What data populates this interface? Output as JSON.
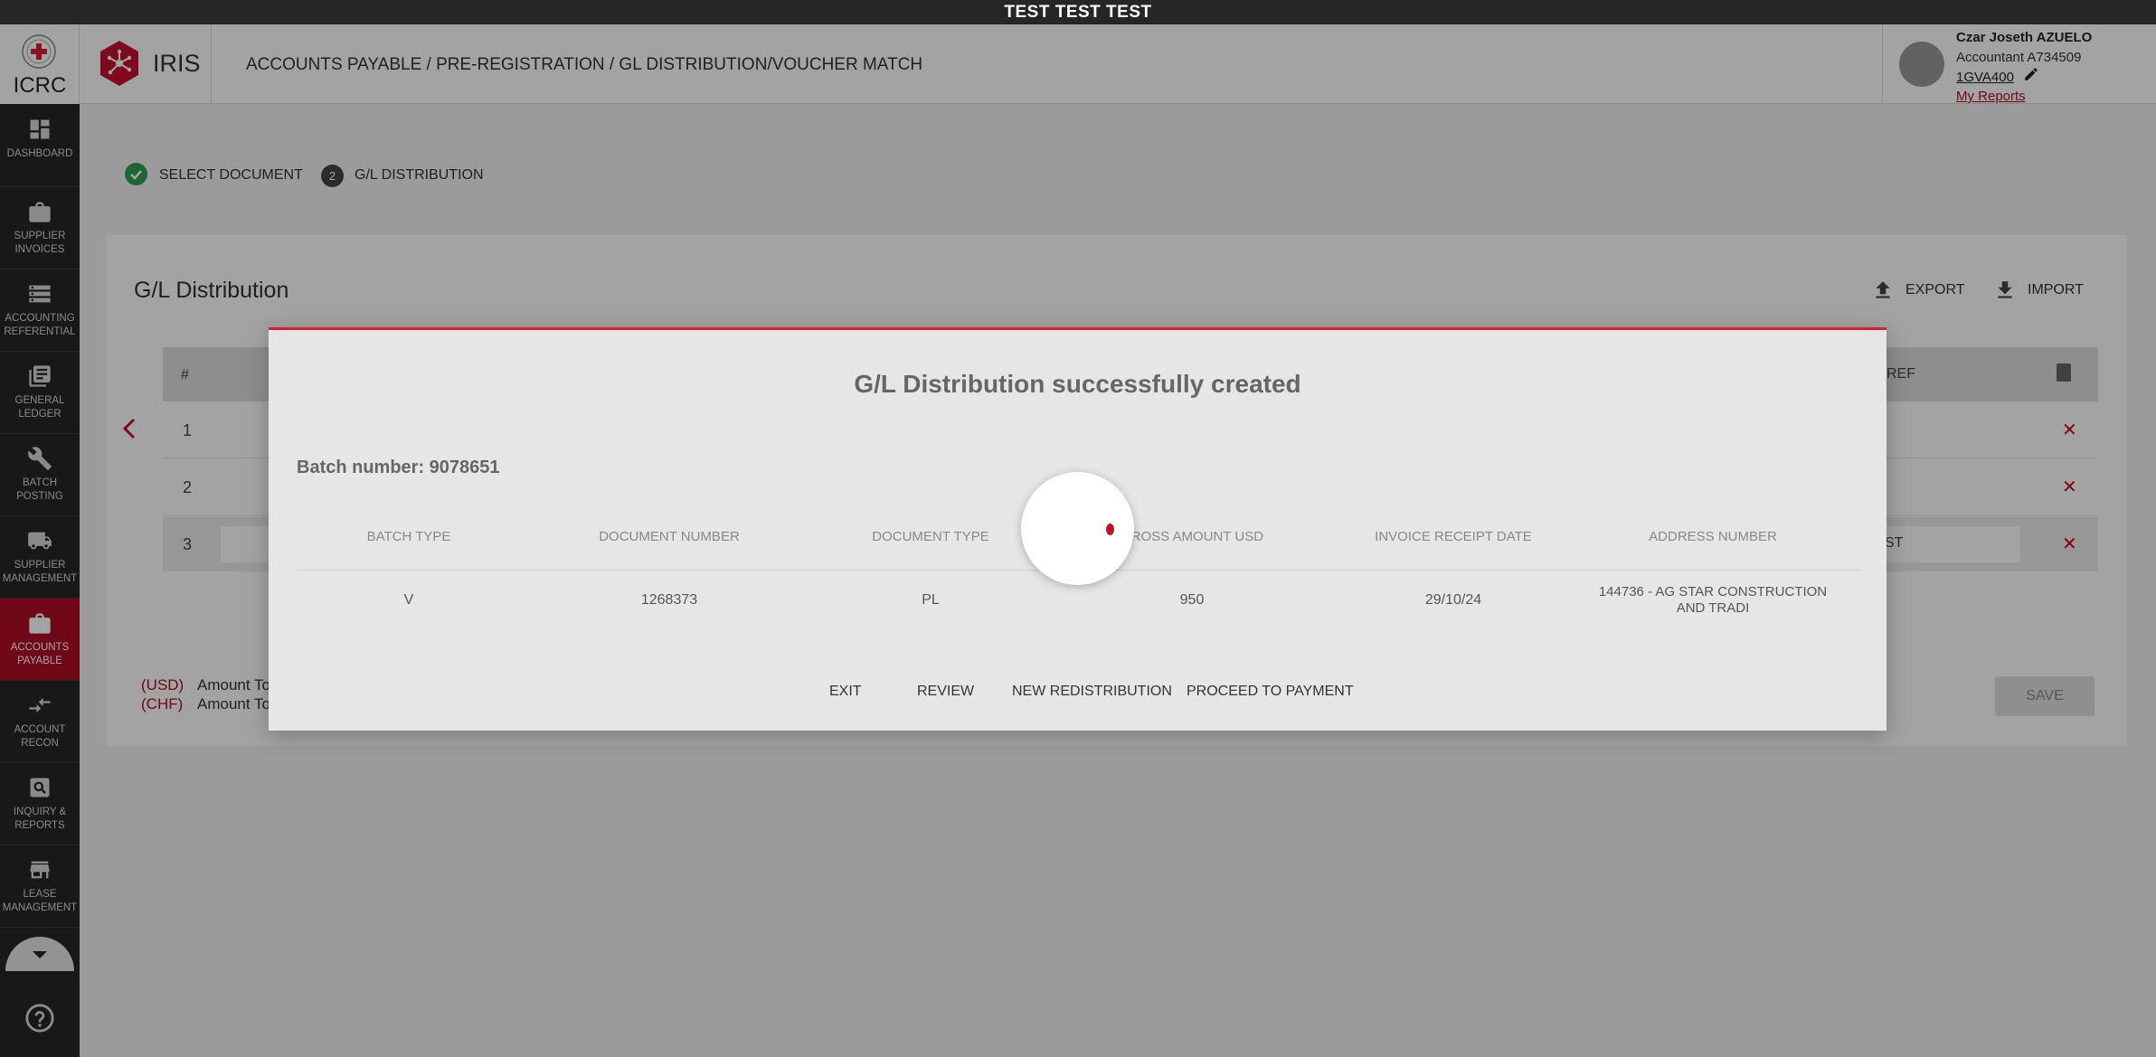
{
  "env_banner": "TEST TEST TEST",
  "brand": {
    "org": "ICRC",
    "app": "IRIS"
  },
  "header": {
    "breadcrumb": "ACCOUNTS PAYABLE / PRE-REGISTRATION / GL DISTRIBUTION/VOUCHER MATCH"
  },
  "user": {
    "name": "Czar Joseth AZUELO",
    "role": "Accountant A734509",
    "code": "1GVA400",
    "reports_link": "My Reports"
  },
  "sidebar": {
    "items": [
      {
        "label": "DASHBOARD",
        "icon": "dashboard-icon"
      },
      {
        "label": "SUPPLIER\nINVOICES",
        "icon": "briefcase-icon"
      },
      {
        "label": "ACCOUNTING\nREFERENTIAL",
        "icon": "storage-icon"
      },
      {
        "label": "GENERAL\nLEDGER",
        "icon": "library-books-icon"
      },
      {
        "label": "BATCH\nPOSTING",
        "icon": "wrench-icon"
      },
      {
        "label": "SUPPLIER\nMANAGEMENT",
        "icon": "truck-icon"
      },
      {
        "label": "ACCOUNTS\nPAYABLE",
        "icon": "briefcase-icon"
      },
      {
        "label": "ACCOUNT\nRECON",
        "icon": "compare-arrows-icon"
      },
      {
        "label": "INQUIRY &\nREPORTS",
        "icon": "search-report-icon"
      },
      {
        "label": "LEASE\nMANAGEMENT",
        "icon": "store-icon"
      }
    ],
    "active_index": 6
  },
  "stepper": {
    "steps": [
      {
        "label": "SELECT DOCUMENT",
        "state": "done"
      },
      {
        "label": "G/L DISTRIBUTION",
        "number": "2",
        "state": "current"
      }
    ]
  },
  "page": {
    "title": "G/L Distribution",
    "export_label": "EXPORT",
    "import_label": "IMPORT",
    "table": {
      "hash_header": "#",
      "ref_header": "REF",
      "rows": [
        "1",
        "2",
        "3"
      ],
      "row3_ref_fragment": "ST"
    },
    "totals": {
      "usd_currency": "(USD)",
      "usd_label": "Amount To",
      "chf_currency": "(CHF)",
      "chf_label": "Amount To"
    },
    "save_label": "SAVE"
  },
  "modal": {
    "title": "G/L Distribution successfully created",
    "batch_label": "Batch number: 9078651",
    "columns": [
      "BATCH TYPE",
      "DOCUMENT NUMBER",
      "DOCUMENT TYPE",
      "GROSS AMOUNT USD",
      "INVOICE RECEIPT DATE",
      "ADDRESS NUMBER"
    ],
    "values": [
      "V",
      "1268373",
      "PL",
      "950",
      "29/10/24",
      "144736 - AG STAR CONSTRUCTION AND TRADI"
    ],
    "actions": {
      "exit": "EXIT",
      "review": "REVIEW",
      "new_redistribution": "NEW REDISTRIBUTION",
      "proceed": "PROCEED TO PAYMENT"
    }
  },
  "colors": {
    "brand_red": "#b00d26",
    "sidebar_bg": "#262626",
    "success_green": "#2e9e4f"
  }
}
